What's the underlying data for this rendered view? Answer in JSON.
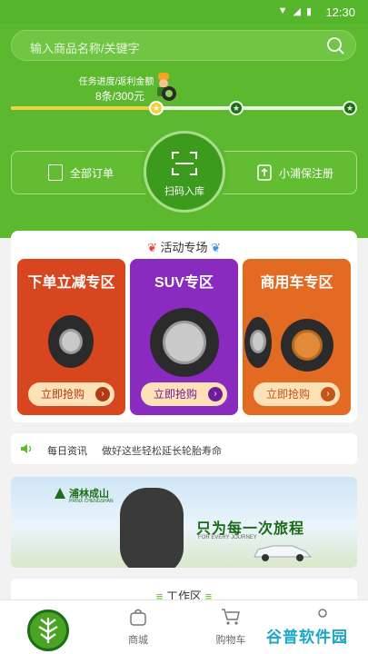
{
  "status_bar": {
    "time": "12:30"
  },
  "search": {
    "placeholder": "输入商品名称/关键字"
  },
  "progress": {
    "label": "任务进度/返利金额",
    "value": "8条/300元",
    "fraction": 0.42
  },
  "actions": {
    "orders_label": "全部订单",
    "scan_label": "扫码入库",
    "warranty_label": "小浦保注册"
  },
  "promo": {
    "title": "活动专场",
    "cards": [
      {
        "title": "下单立减专区",
        "button": "立即抢购",
        "bg": "#d8461f",
        "btn_color": "#b23b17"
      },
      {
        "title": "SUV专区",
        "button": "立即抢购",
        "bg": "#8a2bbf",
        "btn_color": "#6d1f99"
      },
      {
        "title": "商用车专区",
        "button": "立即抢购",
        "bg": "#e36a23",
        "btn_color": "#c5541a"
      }
    ]
  },
  "news": {
    "tag": "每日资讯",
    "text": "做好这些轻松延长轮胎寿命"
  },
  "banner": {
    "brand": "浦林成山",
    "brand_sub": "PRINX CHENGSHAN",
    "slogan": "只为每一次旅程",
    "sub": "FOR EVERY JOURNEY"
  },
  "workzone": {
    "title": "工作区"
  },
  "tabbar": {
    "mall": "商城",
    "cart": "购物车"
  },
  "watermark": "谷普软件园",
  "colors": {
    "brand_green": "#5cb92f",
    "dark_green": "#1e6e18"
  }
}
